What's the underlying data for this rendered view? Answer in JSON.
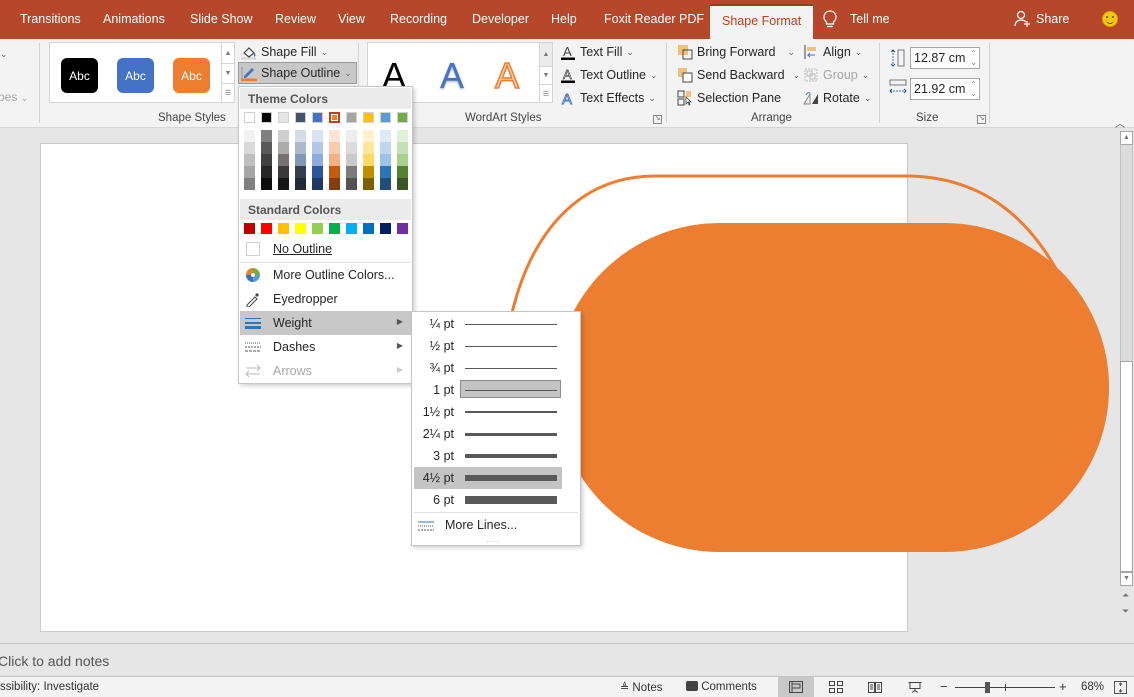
{
  "tabs": [
    {
      "label": "Transitions",
      "active": false
    },
    {
      "label": "Animations",
      "active": false
    },
    {
      "label": "Slide Show",
      "active": false
    },
    {
      "label": "Review",
      "active": false
    },
    {
      "label": "View",
      "active": false
    },
    {
      "label": "Recording",
      "active": false
    },
    {
      "label": "Developer",
      "active": false
    },
    {
      "label": "Help",
      "active": false
    },
    {
      "label": "Foxit Reader PDF",
      "active": false
    },
    {
      "label": "Shape Format",
      "active": true
    }
  ],
  "tell_me": "Tell me",
  "share": "Share",
  "ribbon": {
    "partial_group_label": "pes",
    "shape_styles": {
      "label": "Shape Styles",
      "presets": [
        {
          "text": "Abc",
          "color": "#000000"
        },
        {
          "text": "Abc",
          "color": "#4472c4"
        },
        {
          "text": "Abc",
          "color": "#ed7d31"
        }
      ],
      "shape_fill": "Shape Fill",
      "shape_outline": "Shape Outline"
    },
    "wordart_styles": {
      "label": "WordArt Styles",
      "letters": [
        "A",
        "A",
        "A"
      ],
      "text_fill": "Text Fill",
      "text_outline": "Text Outline",
      "text_effects": "Text Effects"
    },
    "arrange": {
      "label": "Arrange",
      "bring_forward": "Bring Forward",
      "send_backward": "Send Backward",
      "selection_pane": "Selection Pane",
      "align": "Align",
      "group": "Group",
      "rotate": "Rotate"
    },
    "size": {
      "label": "Size",
      "height": "12.87 cm",
      "width": "21.92 cm"
    }
  },
  "outline_menu": {
    "theme_colors_label": "Theme Colors",
    "theme_colors": [
      "#ffffff",
      "#000000",
      "#e7e6e6",
      "#44546a",
      "#4472c4",
      "#ed7d31",
      "#a5a5a5",
      "#ffc000",
      "#5b9bd5",
      "#70ad47"
    ],
    "selected_theme_index": 5,
    "theme_shades": [
      [
        "#f2f2f2",
        "#d9d9d9",
        "#bfbfbf",
        "#a6a6a6",
        "#808080"
      ],
      [
        "#808080",
        "#595959",
        "#404040",
        "#262626",
        "#0d0d0d"
      ],
      [
        "#d0cece",
        "#aeabab",
        "#757171",
        "#3a3838",
        "#171616"
      ],
      [
        "#d6dce4",
        "#adb9ca",
        "#8497b0",
        "#333f4f",
        "#222a35"
      ],
      [
        "#dae3f3",
        "#b4c7e7",
        "#8faadc",
        "#2f5597",
        "#1f3864"
      ],
      [
        "#fbe5d6",
        "#f8cbad",
        "#f4b183",
        "#c55a11",
        "#843c0c"
      ],
      [
        "#ededed",
        "#dbdbdb",
        "#c9c9c9",
        "#7b7b7b",
        "#525252"
      ],
      [
        "#fff2cc",
        "#ffe699",
        "#ffd966",
        "#bf9000",
        "#7f6000"
      ],
      [
        "#deebf7",
        "#bdd7ee",
        "#9dc3e6",
        "#2e75b6",
        "#1f4e79"
      ],
      [
        "#e2f0d9",
        "#c5e0b4",
        "#a9d18e",
        "#548235",
        "#385723"
      ]
    ],
    "standard_colors_label": "Standard Colors",
    "standard_colors": [
      "#c00000",
      "#ff0000",
      "#ffc000",
      "#ffff00",
      "#92d050",
      "#00b050",
      "#00b0f0",
      "#0070c0",
      "#002060",
      "#7030a0"
    ],
    "items": [
      {
        "label": "No Outline",
        "icon": "no-outline-swatch",
        "submenu": false,
        "disabled": false
      },
      {
        "label": "More Outline Colors...",
        "icon": "color-wheel-icon",
        "submenu": false,
        "disabled": false
      },
      {
        "label": "Eyedropper",
        "icon": "eyedropper-icon",
        "submenu": false,
        "disabled": false
      },
      {
        "label": "Weight",
        "icon": "weight-icon",
        "submenu": true,
        "disabled": false,
        "highlighted": true
      },
      {
        "label": "Dashes",
        "icon": "dashes-icon",
        "submenu": true,
        "disabled": false
      },
      {
        "label": "Arrows",
        "icon": "arrows-icon",
        "submenu": true,
        "disabled": true
      }
    ]
  },
  "weight_menu": {
    "items": [
      {
        "label": "¼ pt",
        "pt": 0.25
      },
      {
        "label": "½ pt",
        "pt": 0.5
      },
      {
        "label": "¾ pt",
        "pt": 0.75
      },
      {
        "label": "1 pt",
        "pt": 1,
        "selected": true
      },
      {
        "label": "1½ pt",
        "pt": 1.5
      },
      {
        "label": "2¼ pt",
        "pt": 2.25
      },
      {
        "label": "3 pt",
        "pt": 3
      },
      {
        "label": "4½ pt",
        "pt": 4.5,
        "hovered": true
      },
      {
        "label": "6 pt",
        "pt": 6
      }
    ],
    "more_lines": "More Lines..."
  },
  "slide": {
    "shape_color": "#ed7d31"
  },
  "notes_placeholder": "Click to add notes",
  "status": {
    "accessibility": "ssibility: Investigate",
    "notes": "Notes",
    "comments": "Comments",
    "zoom_percent": "68%",
    "zoom_level": 68
  }
}
